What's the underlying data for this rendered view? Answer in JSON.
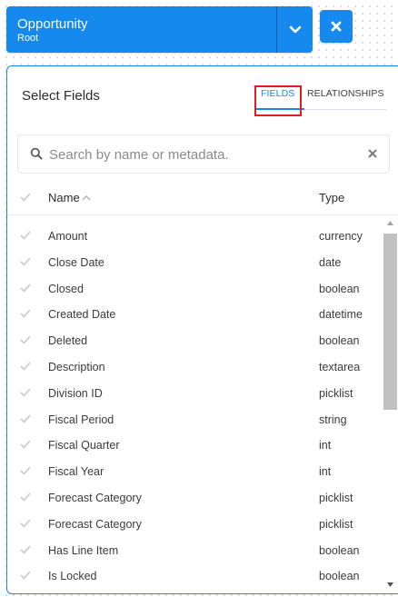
{
  "node": {
    "title": "Opportunity",
    "subtitle": "Root",
    "accent": "#1589ee"
  },
  "panel": {
    "title": "Select Fields",
    "tabs": [
      {
        "label": "FIELDS",
        "active": true
      },
      {
        "label": "RELATIONSHIPS",
        "active": false
      }
    ],
    "search": {
      "placeholder": "Search by name or metadata.",
      "value": ""
    },
    "columns": {
      "name": "Name",
      "type": "Type"
    },
    "rows": [
      {
        "name": "Amount",
        "type": "currency"
      },
      {
        "name": "Close Date",
        "type": "date"
      },
      {
        "name": "Closed",
        "type": "boolean"
      },
      {
        "name": "Created Date",
        "type": "datetime"
      },
      {
        "name": "Deleted",
        "type": "boolean"
      },
      {
        "name": "Description",
        "type": "textarea"
      },
      {
        "name": "Division ID",
        "type": "picklist"
      },
      {
        "name": "Fiscal Period",
        "type": "string"
      },
      {
        "name": "Fiscal Quarter",
        "type": "int"
      },
      {
        "name": "Fiscal Year",
        "type": "int"
      },
      {
        "name": "Forecast Category",
        "type": "picklist"
      },
      {
        "name": "Forecast Category",
        "type": "picklist"
      },
      {
        "name": "Has Line Item",
        "type": "boolean"
      },
      {
        "name": "Is Locked",
        "type": "boolean"
      }
    ]
  },
  "icons": {
    "dropdown": "chevron-down-icon",
    "close": "close-icon",
    "search": "search-icon",
    "clear": "clear-icon",
    "check": "check-icon",
    "sort": "sort-ascending-icon"
  },
  "colors": {
    "accent": "#1589ee",
    "highlight": "#e31c23",
    "check": "#c9c9c9"
  }
}
